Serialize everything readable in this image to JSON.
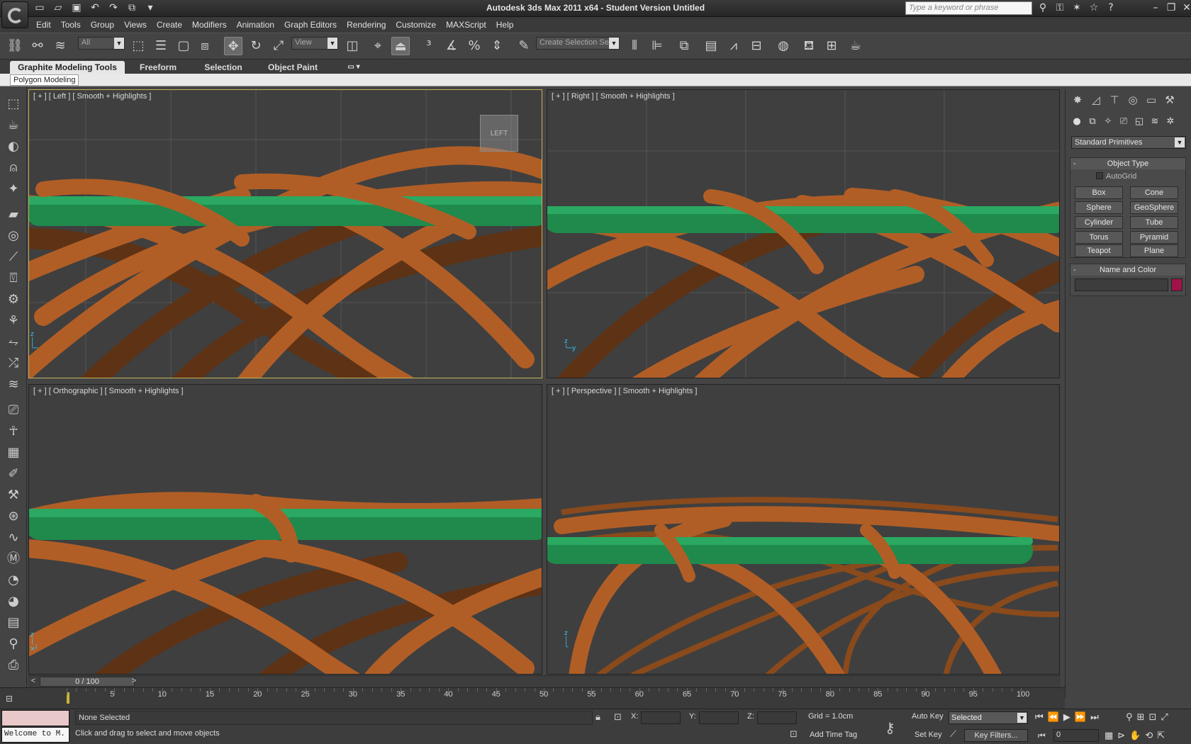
{
  "app": {
    "title": "Autodesk 3ds Max  2011 x64  - Student Version   Untitled",
    "search_placeholder": "Type a keyword or phrase"
  },
  "menu": [
    "Edit",
    "Tools",
    "Group",
    "Views",
    "Create",
    "Modifiers",
    "Animation",
    "Graph Editors",
    "Rendering",
    "Customize",
    "MAXScript",
    "Help"
  ],
  "toolbar": {
    "selection_filter": "All",
    "ref_coord": "View",
    "named_selection": "Create Selection Se"
  },
  "ribbon": {
    "tabs": [
      "Graphite Modeling Tools",
      "Freeform",
      "Selection",
      "Object Paint"
    ],
    "subtab": "Polygon Modeling"
  },
  "viewports": {
    "left": "[ + ] [ Left ] [ Smooth + Highlights ]",
    "right": "[ + ] [ Right ] [ Smooth + Highlights ]",
    "ortho": "[ + ] [ Orthographic ] [ Smooth + Highlights ]",
    "persp": "[ + ] [ Perspective ] [ Smooth + Highlights ]",
    "viewcube": "LEFT"
  },
  "command_panel": {
    "dropdown": "Standard Primitives",
    "object_type": "Object Type",
    "autogrid": "AutoGrid",
    "buttons": [
      "Box",
      "Cone",
      "Sphere",
      "GeoSphere",
      "Cylinder",
      "Tube",
      "Torus",
      "Pyramid",
      "Teapot",
      "Plane"
    ],
    "name_color": "Name and Color",
    "object_color": "#a0134a"
  },
  "timeline": {
    "slider": "0 / 100",
    "ticks": [
      "5",
      "10",
      "15",
      "20",
      "25",
      "30",
      "35",
      "40",
      "45",
      "50",
      "55",
      "60",
      "65",
      "70",
      "75",
      "80",
      "85",
      "90",
      "95",
      "100"
    ]
  },
  "status": {
    "selection": "None Selected",
    "prompt": "Click and drag to select and move objects",
    "maxscript": "Welcome to M.",
    "x_label": "X:",
    "y_label": "Y:",
    "z_label": "Z:",
    "grid": "Grid = 1.0cm",
    "add_time_tag": "Add Time Tag",
    "auto_key": "Auto Key",
    "set_key": "Set Key",
    "key_mode": "Selected",
    "key_filters": "Key Filters...",
    "frame": "0"
  }
}
